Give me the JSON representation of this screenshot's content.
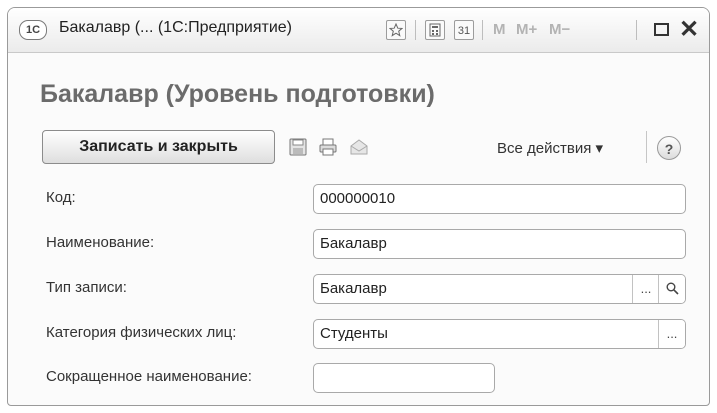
{
  "window": {
    "logo": "1С",
    "title": "Бакалавр (... (1С:Предприятие)",
    "m_buttons": [
      "M",
      "M+",
      "M−"
    ],
    "calendar_day": "31"
  },
  "form": {
    "heading": "Бакалавр (Уровень подготовки)"
  },
  "toolbar": {
    "save_close_label": "Записать и закрыть",
    "all_actions_label": "Все действия ▾",
    "help_label": "?"
  },
  "fields": [
    {
      "label": "Код:",
      "value": "000000010"
    },
    {
      "label": "Наименование:",
      "value": "Бакалавр"
    },
    {
      "label": "Тип записи:",
      "value": "Бакалавр",
      "buttons": [
        "...",
        "search-icon"
      ]
    },
    {
      "label": "Категория физических лиц:",
      "value": "Студенты",
      "buttons": [
        "..."
      ]
    },
    {
      "label": "Сокращенное наименование:",
      "value": ""
    }
  ]
}
